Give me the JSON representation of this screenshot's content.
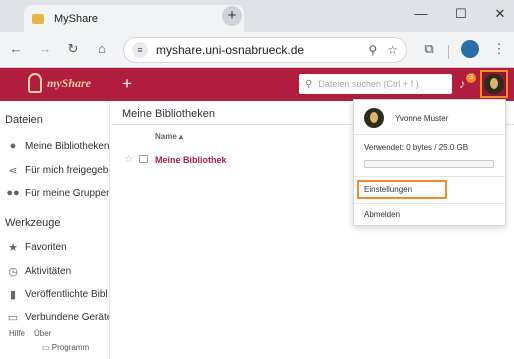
{
  "browser": {
    "tab_title": "MyShare",
    "tab_close": "✕",
    "new_tab": "+",
    "url": "myshare.uni-osnabrueck.de",
    "window_controls": [
      "—",
      "☐",
      "✕"
    ]
  },
  "header": {
    "logo_text": "myShare",
    "add_icon": "+",
    "search_placeholder": "Dateien suchen (Ctrl + f )",
    "notification_count": "3"
  },
  "sidebar": {
    "files_title": "Dateien",
    "files_items": [
      {
        "label": "Meine Bibliotheken",
        "icon": "person-icon"
      },
      {
        "label": "Für mich freigegeben",
        "icon": "share-icon"
      },
      {
        "label": "Für meine Gruppen",
        "icon": "group-icon"
      }
    ],
    "tools_title": "Werkzeuge",
    "tools_items": [
      {
        "label": "Favoriten",
        "icon": "star-icon"
      },
      {
        "label": "Aktivitäten",
        "icon": "history-icon"
      },
      {
        "label": "Veröffentlichte Bibl",
        "icon": "book-icon"
      },
      {
        "label": "Verbundene Geräte",
        "icon": "device-icon"
      }
    ],
    "footer": {
      "help": "Hilfe",
      "about": "Über",
      "program": "Programm"
    }
  },
  "main": {
    "title": "Meine Bibliotheken",
    "column_name": "Name ▴",
    "libraries": [
      {
        "name": "Meine Bibliothek"
      }
    ]
  },
  "user_menu": {
    "name": "Yvonne Muster",
    "usage": "Verwendet: 0 bytes / 25.0 GB",
    "usage_fraction": 0,
    "settings": "Einstellungen",
    "logout": "Abmelden"
  },
  "colors": {
    "brand": "#b01d3f",
    "highlight": "#f28c28"
  }
}
